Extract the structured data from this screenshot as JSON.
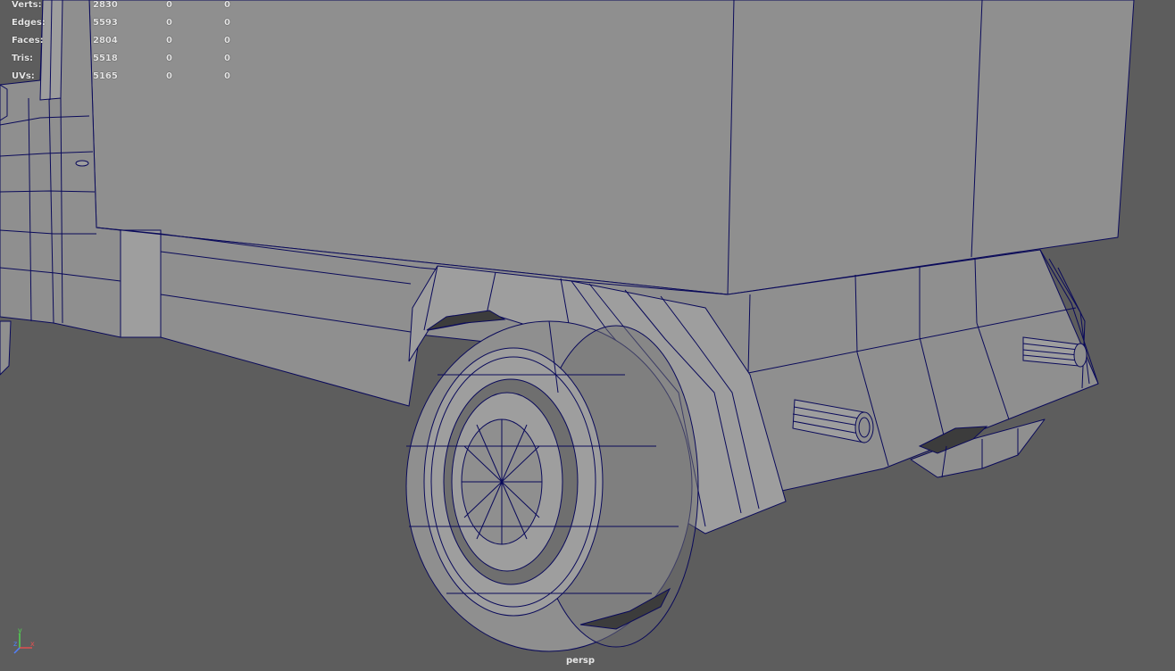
{
  "viewport": {
    "camera": "persp",
    "background": "#5d5d5d",
    "mesh_color": "#8f8f8f",
    "wire_color": "#0a0a5a"
  },
  "hud": {
    "rows": [
      {
        "label": "Verts:",
        "v1": "2830",
        "v2": "0",
        "v3": "0"
      },
      {
        "label": "Edges:",
        "v1": "5593",
        "v2": "0",
        "v3": "0"
      },
      {
        "label": "Faces:",
        "v1": "2804",
        "v2": "0",
        "v3": "0"
      },
      {
        "label": "Tris:",
        "v1": "5518",
        "v2": "0",
        "v3": "0"
      },
      {
        "label": "UVs:",
        "v1": "5165",
        "v2": "0",
        "v3": "0"
      }
    ]
  },
  "axis_gizmo": {
    "y": "y",
    "z": "z",
    "x": "x"
  }
}
